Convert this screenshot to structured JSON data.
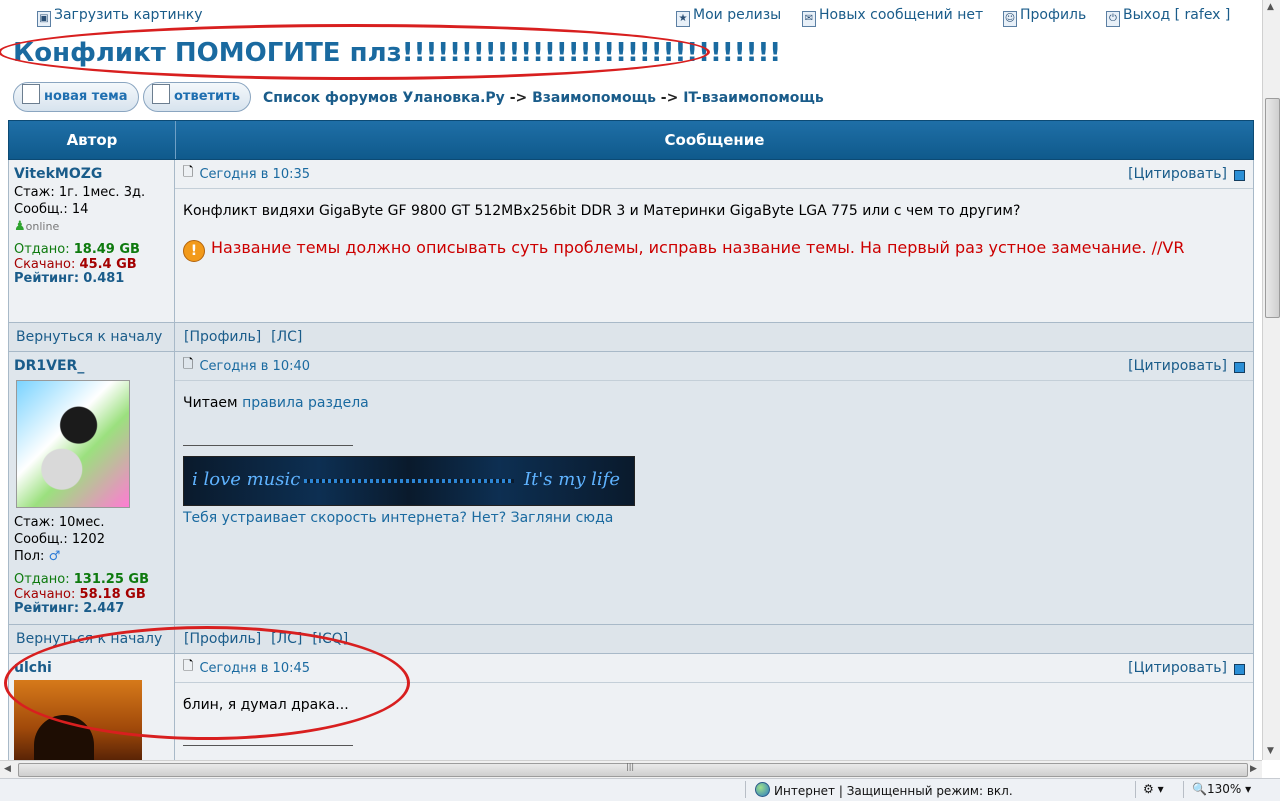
{
  "topnav": {
    "upload": "Загрузить картинку",
    "releases": "Мои релизы",
    "messages": "Новых сообщений нет",
    "profile": "Профиль",
    "logout": "Выход [ rafex ]"
  },
  "topic": {
    "title": "Конфликт ПОМОГИТЕ плз!!!!!!!!!!!!!!!!!!!!!!!!!!!!!!!!"
  },
  "buttons": {
    "new_topic": "новая тема",
    "reply": "ответить"
  },
  "breadcrumb": {
    "items": [
      "Список форумов Улановка.Ру",
      "Взаимопомощь",
      "IT-взаимопомощь"
    ],
    "sep": "->"
  },
  "table": {
    "col_author": "Автор",
    "col_message": "Сообщение"
  },
  "posts": [
    {
      "author": "VitekMOZG",
      "stazh": "Стаж: 1г. 1мес. 3д.",
      "posts_count": "Сообщ.: 14",
      "online": "online",
      "uploaded_label": "Отдано:",
      "uploaded": "18.49 GB",
      "downloaded_label": "Скачано:",
      "downloaded": "45.4 GB",
      "rating_label": "Рейтинг:",
      "rating": "0.481",
      "time": "Сегодня в 10:35",
      "quote": "[Цитировать]",
      "text": "Конфликт видяхи GigaByte GF 9800 GT 512MBx256bit DDR 3 и Материнки GigaByte LGA 775 или с чем то другим?",
      "warning": "Название темы должно описывать суть проблемы, исправь название темы. На первый раз устное замечание. //VR",
      "footer_top": "Вернуться к началу",
      "footer_links": [
        "[Профиль]",
        "[ЛС]"
      ]
    },
    {
      "author": "DR1VER_",
      "stazh": "Стаж: 10мес.",
      "posts_count": "Сообщ.: 1202",
      "gender": "Пол:",
      "uploaded_label": "Отдано:",
      "uploaded": "131.25 GB",
      "downloaded_label": "Скачано:",
      "downloaded": "58.18 GB",
      "rating_label": "Рейтинг:",
      "rating": "2.447",
      "time": "Сегодня в 10:40",
      "quote": "[Цитировать]",
      "text_prefix": "Читаем ",
      "text_link": "правила раздела",
      "banner_left": "i love music",
      "banner_right": "It's my life",
      "sig_link": "Тебя устраивает скорость интернета? Нет? Загляни сюда",
      "footer_top": "Вернуться к началу",
      "footer_links": [
        "[Профиль]",
        "[ЛС]",
        "[ICQ]"
      ]
    },
    {
      "author": "ulchi",
      "time": "Сегодня в 10:45",
      "quote": "[Цитировать]",
      "text": "блин, я думал драка..."
    }
  ],
  "statusbar": {
    "zone": "Интернет | Защищенный режим: вкл.",
    "zoom": "130%"
  },
  "colors": {
    "annotation": "#d81f1f",
    "header": "#1f6fa7",
    "link": "#1a5c8a"
  }
}
